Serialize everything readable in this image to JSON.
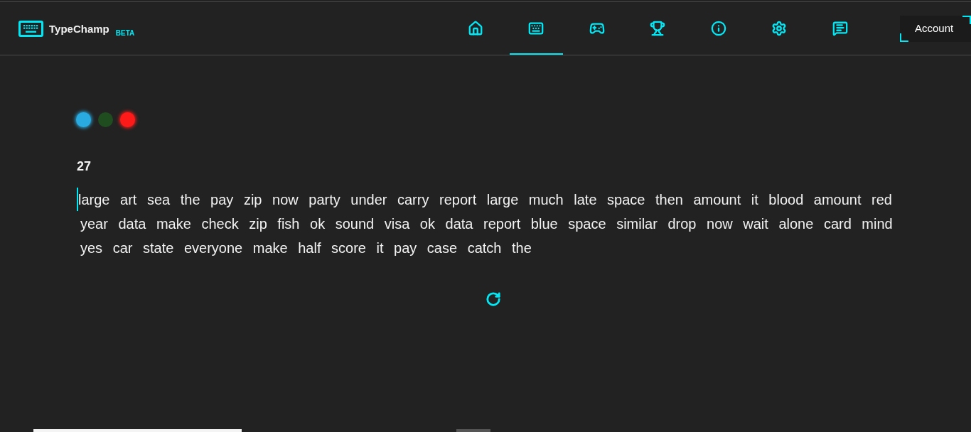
{
  "header": {
    "logo": {
      "title": "TypeChamp",
      "badge": "BETA"
    },
    "nav": [
      {
        "selected": false
      },
      {
        "selected": true
      },
      {
        "selected": false
      },
      {
        "selected": false
      },
      {
        "selected": false
      },
      {
        "selected": false
      },
      {
        "selected": false
      }
    ],
    "account_button": {
      "label": "Account"
    }
  },
  "indicators": [
    {
      "color": "#29abe2",
      "lit": true
    },
    {
      "color": "#1f4d20",
      "lit": false
    },
    {
      "color": "#ff1a1a",
      "lit": true
    }
  ],
  "counter": "27",
  "typing_test": {
    "text": "large art sea the pay zip now party under carry report large much late space then amount it blood amount red year data make check zip fish ok sound visa ok data report blue space similar drop now wait alone card mind yes car state everyone make half score it pay case catch the"
  }
}
